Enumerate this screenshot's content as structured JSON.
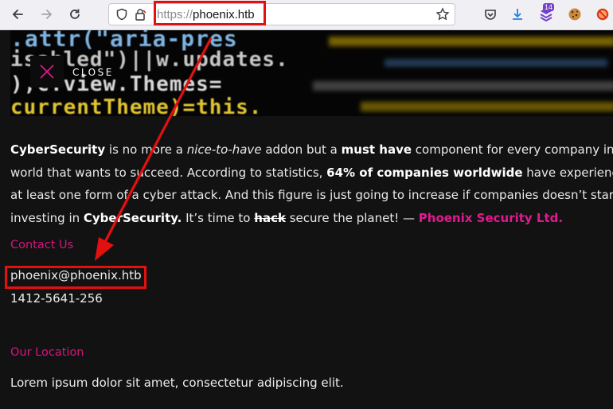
{
  "browser": {
    "url_protocol": "https://",
    "url_host": "phoenix.htb",
    "extension_badge": "14",
    "icons": [
      "back-icon",
      "forward-icon",
      "reload-icon",
      "shield-icon",
      "lock-icon",
      "star-icon",
      "pocket-icon",
      "download-icon",
      "extension-icon",
      "cookie-icon",
      "blocker-icon"
    ]
  },
  "hero": {
    "code_lines": [
      ".attr(\"aria-pres",
      "isabled\")||w.updates.",
      "),c.view.Themes=",
      "currentTheme)=this."
    ],
    "close_label": "CLOSE"
  },
  "content": {
    "line1": {
      "a": "CyberSecurity",
      "b": " is no more a ",
      "c": "nice-to-have",
      "d": " addon but a ",
      "e": "must have",
      "f": " component for every company in the"
    },
    "line2": {
      "a": "world that wants to succeed. According to statistics, ",
      "b": "64% of companies worldwide",
      "c": " have experienced"
    },
    "line3": "at least one form of a cyber attack. And this figure is just going to increase if companies doesn’t start",
    "line4": {
      "a": "investing in ",
      "b": "CyberSecurity.",
      "c": " It’s time to ",
      "d": "hack",
      "e": " secure the planet! — ",
      "f": "Phoenix Security Ltd."
    }
  },
  "contact": {
    "title": "Contact Us",
    "email": "phoenix@phoenix.htb",
    "phone": "1412-5641-256"
  },
  "location": {
    "title": "Our Location",
    "address": "Lorem ipsum dolor sit amet, consectetur adipiscing elit."
  },
  "colors": {
    "accent": "#e0198e",
    "annotation": "#e31010",
    "background": "#121212"
  }
}
